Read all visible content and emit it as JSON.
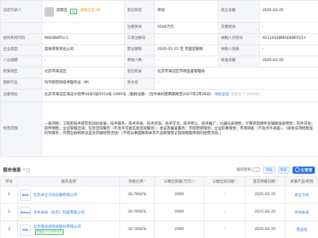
{
  "info": {
    "legal_rep_label": "法定代表人",
    "legal_rep_name": "邵霏宣",
    "legal_rep_badge": "仓",
    "legal_rep_tag": "关联企业 20",
    "reg_status_label": "登记状态",
    "reg_status_value": "存续",
    "founded_label": "成立日期",
    "founded_value": "2025-02-25",
    "reg_capital_label": "注册资本",
    "reg_capital_value": "6500万元",
    "paid_capital_label": "实缴资本",
    "paid_capital_value": "-",
    "org_code_label": "组织机构代码",
    "org_code_value": "MAEBNRTU-1",
    "biz_reg_label": "工商注册号",
    "biz_reg_value": "-",
    "taxpayer_id_label": "纳税人识别号",
    "taxpayer_id_value": "91110108MAEBNRTU1Y",
    "company_type_label": "企业类型",
    "company_type_value": "其他有限责任公司",
    "term_label": "营业期限",
    "term_value": "2025-02-25 至 无固定期限",
    "taxpayer_qual_label": "纳税人资质",
    "taxpayer_qual_value": "-",
    "staff_label": "人员规模",
    "staff_value": "-",
    "insured_label": "参保人数",
    "insured_value": "-",
    "approved_label": "核准日期",
    "approved_value": "2025-02-25",
    "region_label": "所属地区",
    "region_value": "北京市海淀区",
    "authority_label": "登记机关",
    "authority_value": "北京市海淀区市场监督管理局",
    "industry_label": "国标行业",
    "industry_value": "科学研究和技术服务业（M）",
    "english_label": "英文名",
    "english_value": "-",
    "address_label": "注册地址",
    "address_value": "北京市海淀区海淀大街甲36号5层5014号-1085号（集群注册）（在中关村使用期限至2027年2月26日）",
    "address_link": "附近企业",
    "address_extra": "该地址下(89988)",
    "scope_label": "经营范围",
    "scope_value": "一般项目：工程和技术研究和试验发展；技术服务、技术开发、技术咨询、技术交流、技术转让、技术推广；仪器仪表销售；计算机软硬件及辅助设备零售；软件开发；软件销售；企业管理咨询；信息咨询服务（不含许可类信息咨询服务）；会议及展览服务；市场营销策划；企业形象策划；市场调查（不含涉外调查）。（除依法须经批准的项目外，凭营业执照依法自主开展经营活动）（不得从事国家和本市产业政策禁止和限制类项目的经营活动。）"
  },
  "branches": {
    "title": "股东信息",
    "count": "4",
    "toggle_label": "股权结构",
    "filter_label": "导出",
    "hint": "投诉",
    "logo_text": "企查查",
    "columns": [
      "序号",
      "股东名称",
      "持股比例",
      "认缴出资额(万元)",
      "认缴出资日期",
      "首次持股日期",
      "关联产品/机构"
    ],
    "rows": [
      {
        "no": "1",
        "logo": "Belis",
        "name": "北京卓立汉光仪器有限公司",
        "tag": "",
        "ratio": "30.7692%",
        "capital": "2000",
        "date": "-",
        "first": "2025-02-25",
        "product": "卓立汉光"
      },
      {
        "no": "2",
        "logo": "Mimas",
        "name": "木木米米（北京）科技有限公司",
        "tag": "",
        "ratio": "30.7692%",
        "capital": "2000",
        "date": "-",
        "first": "2025-02-25",
        "product": "木木米米"
      },
      {
        "no": "3",
        "logo": "SDIL",
        "name": "北京雪迪龙科技股份有限公司",
        "tag": "雪迪龙 002658.SZ",
        "ratio": "30.7692%",
        "capital": "2000",
        "date": "-",
        "first": "2025-02-25",
        "product": "雪迪龙"
      }
    ]
  }
}
